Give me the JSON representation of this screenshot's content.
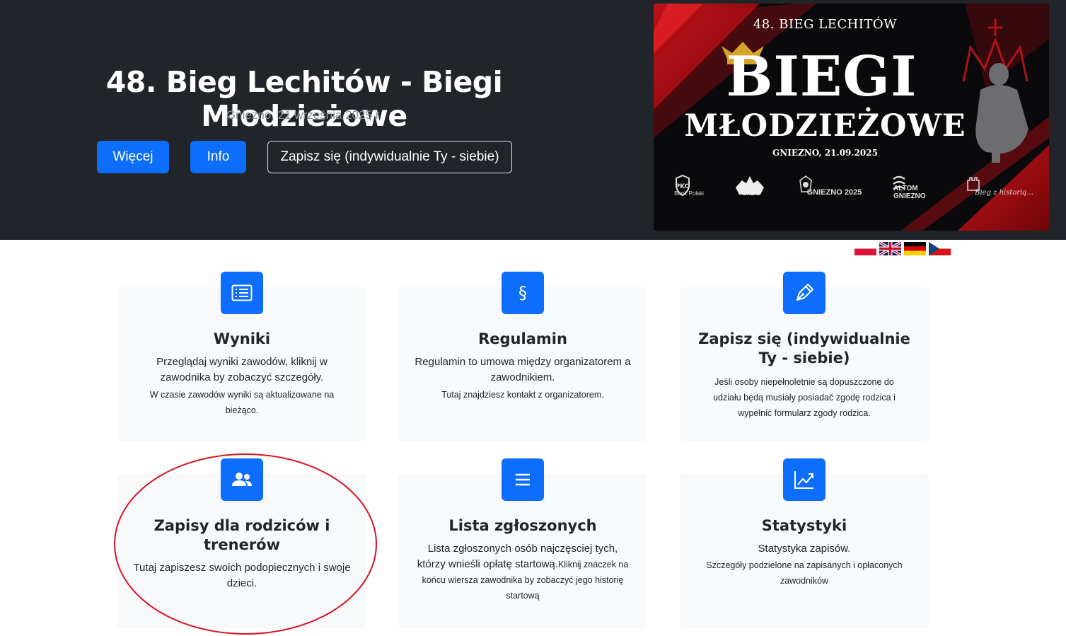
{
  "hero": {
    "title": "48. Bieg Lechitów - Biegi Młodzieżowe",
    "subtitle": "Gniezno, 21 września 2025 r.",
    "buttons": {
      "more": "Więcej",
      "info": "Info",
      "signup": "Zapisz się (indywidualnie Ty - siebie)"
    }
  },
  "banner": {
    "top": "48. BIEG LECHITÓW",
    "big": "BIEGI",
    "mid": "MŁODZIEŻOWE",
    "date": "GNIEZNO, 21.09.2025",
    "sponsors": [
      "Bank Polski",
      "URBIS",
      "GNIEZNO 2025",
      "ALTOM GNIEZNO",
      "Bieg z historią..."
    ]
  },
  "flags": [
    "pl",
    "en",
    "de",
    "cz"
  ],
  "cards": [
    {
      "icon": "list-icon",
      "title": "Wyniki",
      "text": "Przeglądaj wyniki zawodów, kliknij w zawodnika by zobaczyć szczegóły.",
      "small": "W czasie zawodów wyniki są aktualizowane na bieżąco."
    },
    {
      "icon": "paragraph-icon",
      "title": "Regulamin",
      "text": "Regulamin to umowa między organizatorem a zawodnikiem.",
      "small": "Tutaj znajdziesz kontakt z organizatorem."
    },
    {
      "icon": "pen-icon",
      "title": "Zapisz się (indywidualnie Ty - siebie)",
      "small": "Jeśli osoby niepełnoletnie są dopuszczone do udziału będą musiały posiadać zgodę rodzica i wypełnić formularz zgody rodzica."
    },
    {
      "icon": "users-icon",
      "title": "Zapisy dla rodziców i trenerów",
      "text": "Tutaj zapiszesz swoich podopiecznych i swoje dzieci."
    },
    {
      "icon": "menu-icon",
      "title": "Lista zgłoszonych",
      "text": "Lista zgłoszonych osób najczęsciej tych, którzy wnieśli opłatę startową.",
      "small": "Kliknij znaczek na końcu wiersza zawodnika by zobaczyć jego historię startową"
    },
    {
      "icon": "chart-icon",
      "title": "Statystyki",
      "text": "Statystyka zapisów.",
      "small": "Szczegóły podzielone na zapisanych i opłaconych zawodników"
    }
  ],
  "colors": {
    "hero_bg": "#212529",
    "primary": "#0d6efd",
    "card_bg": "#f8f9fa",
    "highlight": "#d9121f"
  }
}
